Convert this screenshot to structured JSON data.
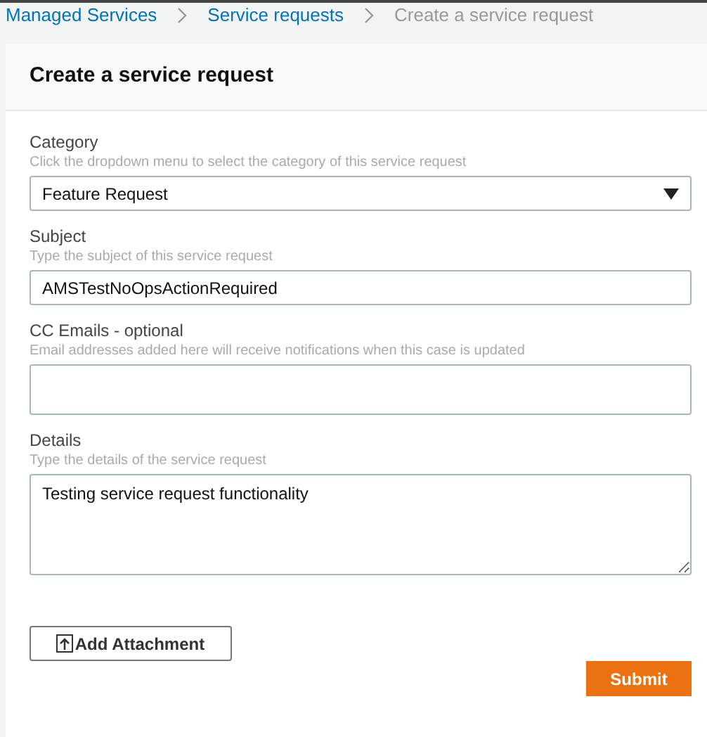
{
  "breadcrumb": [
    {
      "label": "Managed Services",
      "kind": "link"
    },
    {
      "label": "Service requests",
      "kind": "link"
    },
    {
      "label": "Create a service request",
      "kind": "current"
    }
  ],
  "card": {
    "title": "Create a service request"
  },
  "fields": [
    {
      "kind": "select",
      "label": "Category",
      "hint": "Click the dropdown menu to select the category of this service request",
      "value": "Feature Request"
    },
    {
      "kind": "input",
      "label": "Subject",
      "hint": "Type the subject of this service request",
      "value": "AMSTestNoOpsActionRequired"
    },
    {
      "kind": "input",
      "label": "CC Emails - optional",
      "hint": "Email addresses added here will receive notifications when this case is updated"
    },
    {
      "kind": "textarea",
      "label": "Details",
      "hint": "Type the details of the service request",
      "value": "Testing service request functionality"
    }
  ],
  "attachment_button": "Add Attachment",
  "submit_button": "Submit"
}
